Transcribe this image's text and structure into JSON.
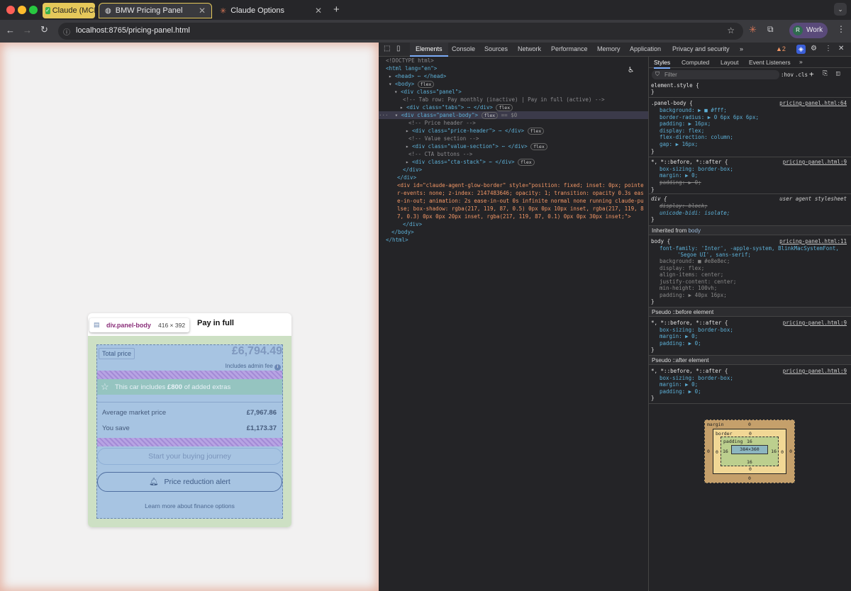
{
  "browser": {
    "tabs": [
      {
        "label": "Claude (MCP)"
      },
      {
        "label": "BMW Pricing Panel"
      },
      {
        "label": "Claude Options"
      }
    ],
    "url": "localhost:8765/pricing-panel.html",
    "profile": "Work",
    "profile_initial": "R"
  },
  "tooltip": {
    "selector": "div.panel-body",
    "size": "416 × 392"
  },
  "panel": {
    "tab_active": "Pay in full",
    "total_label": "Total price",
    "total_value": "£6,794.49",
    "admin_fee": "Includes admin fee",
    "extras_prefix": "This car includes ",
    "extras_amount": "£800",
    "extras_suffix": " of added extras",
    "rows": [
      {
        "label": "Average market price",
        "value": "£7,967.86"
      },
      {
        "label": "You save",
        "value": "£1,173.37"
      }
    ],
    "cta_primary": "Start your buying journey",
    "cta_alert": "Price reduction alert",
    "finance_link": "Learn more about finance options"
  },
  "devtools": {
    "tabs": [
      "Elements",
      "Console",
      "Sources",
      "Network",
      "Performance",
      "Memory",
      "Application",
      "Privacy and security"
    ],
    "issue_count": "2",
    "style_tabs": [
      "Styles",
      "Computed",
      "Layout",
      "Event Listeners"
    ],
    "filter_placeholder": "Filter",
    "hov": ":hov",
    "cls": ".cls",
    "dom": [
      "<!DOCTYPE html>",
      "<html lang=\"en\">",
      "<head> ⋯ </head>",
      "<body>",
      "<div class=\"panel\">",
      "<!-- Tab row: Pay monthly (inactive) | Pay in full (active) -->",
      "<div class=\"tabs\"> ⋯ </div>",
      "<div class=\"panel-body\">",
      "<!-- Price header -->",
      "<div class=\"price-header\"> ⋯ </div>",
      "<!-- Value section -->",
      "<div class=\"value-section\"> ⋯ </div>",
      "<!-- CTA buttons -->",
      "<div class=\"cta-stack\"> ⋯ </div>",
      "</div>",
      "</div>",
      "<div id=\"claude-agent-glow-border\" style=\"position: fixed; inset: 0px; pointe",
      "r-events: none; z-index: 2147483646; opacity: 1; transition: opacity 0.3s eas",
      "e-in-out; animation: 2s ease-in-out 0s infinite normal none running claude-pu",
      "lse; box-shadow: rgba(217, 119, 87, 0.5) 0px 0px 10px inset, rgba(217, 119, 8",
      "7, 0.3) 0px 0px 20px inset, rgba(217, 119, 87, 0.1) 0px 0px 30px inset;\">",
      "</div>",
      "</body>",
      "</html>"
    ],
    "flex_badge": "flex",
    "eq_badge": "== $0",
    "styles": {
      "element_style": "element.style {",
      "rule1_selector": ".panel-body {",
      "rule1_src": "pricing-panel.html:64",
      "rule1_props": [
        "background: ▶ ■ #fff;",
        "border-radius: ▶ 0 6px 6px 6px;",
        "padding: ▶ 16px;",
        "display: flex;",
        "flex-direction: column;",
        "gap: ▶ 16px;"
      ],
      "rule2_selector": "*, *::before, *::after {",
      "rule2_src": "pricing-panel.html:9",
      "rule2_props": [
        "box-sizing: border-box;",
        "margin: ▶ 0;",
        "padding: ▶ 0;"
      ],
      "rule3_selector": "div {",
      "rule3_src": "user agent stylesheet",
      "rule3_props": [
        "display: block;",
        "unicode-bidi: isolate;"
      ],
      "inherited_label": "Inherited from",
      "inherited_from": "body",
      "body_selector": "body {",
      "body_src": "pricing-panel.html:11",
      "body_props": [
        "font-family: 'Inter', -apple-system, BlinkMacSystemFont,",
        "'Segoe UI', sans-serif;",
        "background: ■ #e8e8ec;",
        "display: flex;",
        "align-items: center;",
        "justify-content: center;",
        "min-height: 100vh;",
        "padding: ▶ 40px 16px;"
      ],
      "before_label": "Pseudo ::before element",
      "after_label": "Pseudo ::after element",
      "close": "}"
    },
    "boxmodel": {
      "margin_label": "margin",
      "margin": "0",
      "border_label": "border",
      "border": "0",
      "padding_label": "padding",
      "padding": "16",
      "content": "384×360"
    }
  }
}
